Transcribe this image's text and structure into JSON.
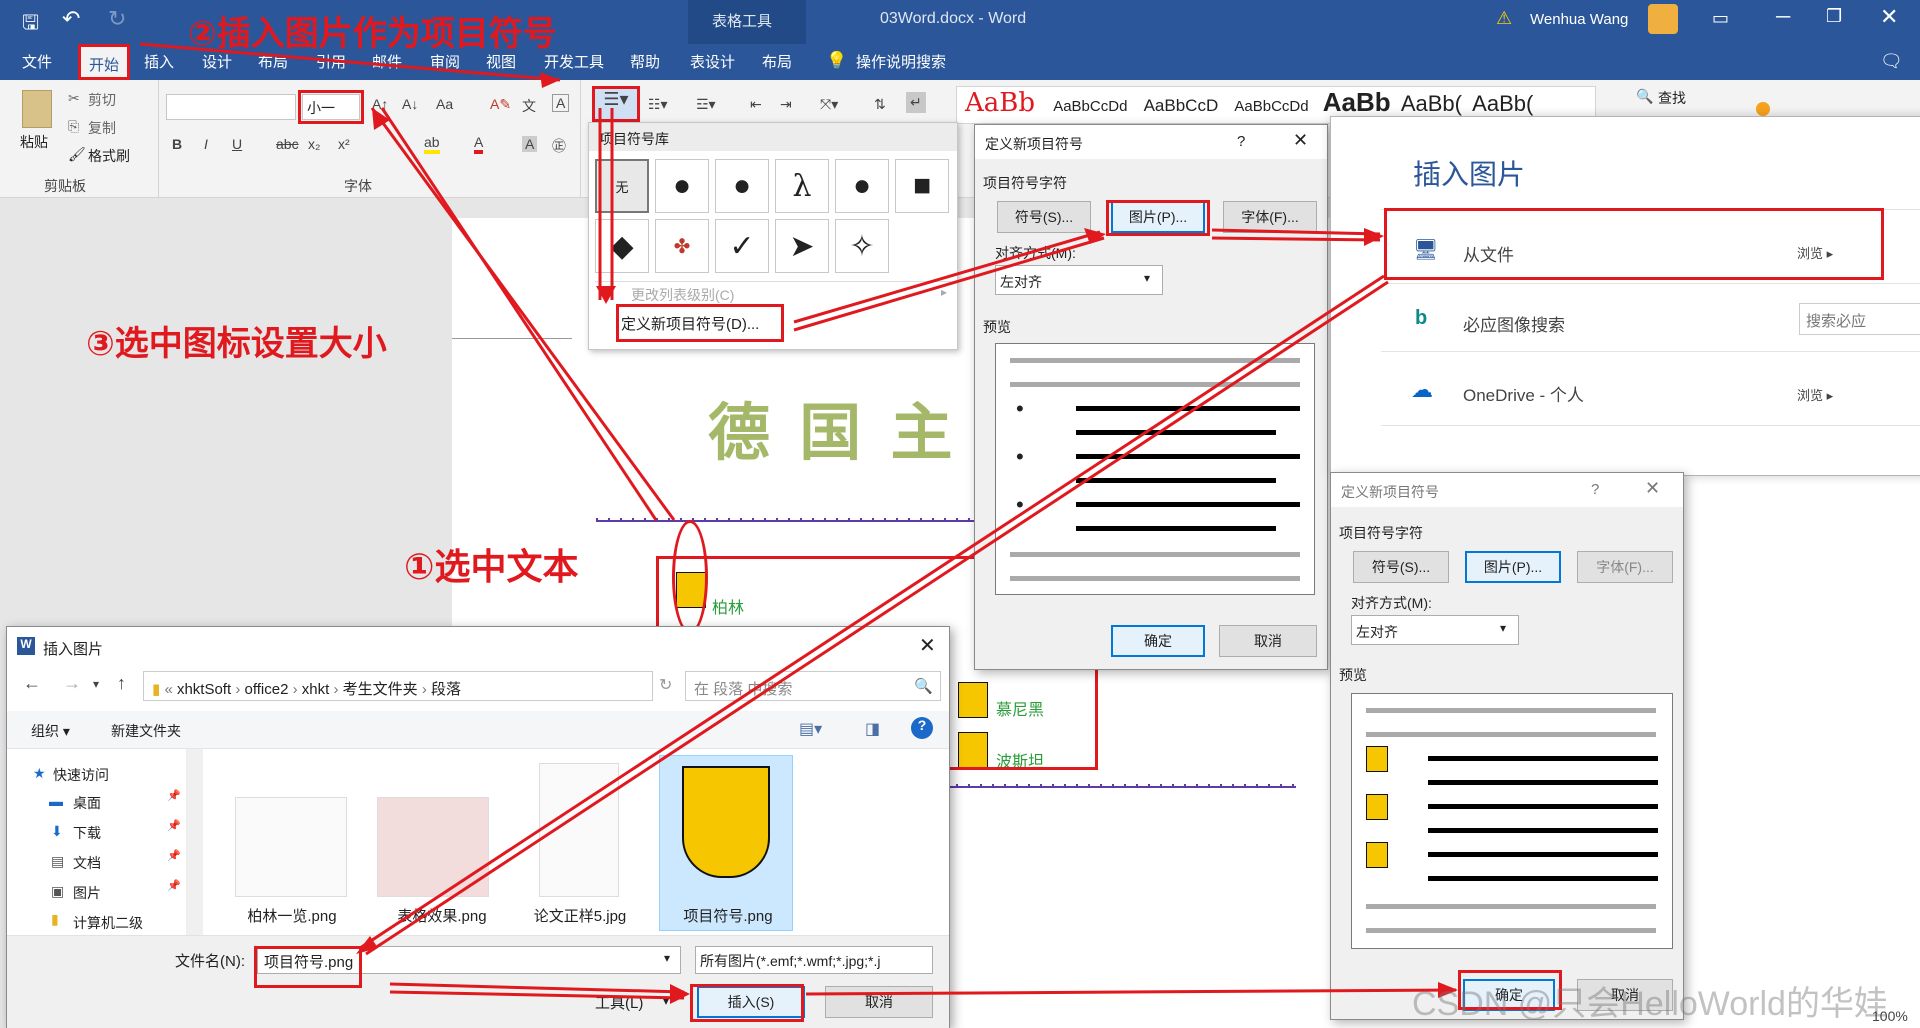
{
  "window": {
    "title": "03Word.docx - Word",
    "context_tab": "表格工具",
    "user": "Wenhua Wang"
  },
  "tabs": [
    "文件",
    "开始",
    "插入",
    "设计",
    "布局",
    "引用",
    "邮件",
    "审阅",
    "视图",
    "开发工具",
    "帮助",
    "表设计",
    "布局"
  ],
  "tell_me": "操作说明搜索",
  "clipboard": {
    "paste": "粘贴",
    "cut": "剪切",
    "copy": "复制",
    "format_painter": "格式刷",
    "group": "剪贴板"
  },
  "font": {
    "size": "小一",
    "group": "字体"
  },
  "styles": [
    "AaBb",
    "AaBbCcDd",
    "AaBbCcD",
    "AaBbCcDd",
    "AaBb",
    "AaBb(",
    "AaBb("
  ],
  "find": "查找",
  "gallery": {
    "header": "项目符号库",
    "none": "无",
    "symbols": [
      "●",
      "●",
      "λ",
      "●",
      "■",
      "◆",
      "✤",
      "✓",
      "➤",
      "✧"
    ],
    "change_level": "更改列表级别(C)",
    "define_new": "定义新项目符号(D)..."
  },
  "annotations": {
    "step1": "①选中文本",
    "step2": "②插入图片作为项目符号",
    "step3": "③选中图标设置大小"
  },
  "document": {
    "heading": "德 国 主 要",
    "items": [
      "柏林",
      "慕尼黑",
      "波斯坦"
    ]
  },
  "define_dialog": {
    "title": "定义新项目符号",
    "help": "?",
    "section": "项目符号字符",
    "symbol_btn": "符号(S)...",
    "picture_btn": "图片(P)...",
    "font_btn": "字体(F)...",
    "align_label": "对齐方式(M):",
    "align_value": "左对齐",
    "preview_label": "预览",
    "ok": "确定",
    "cancel": "取消"
  },
  "insert_pane": {
    "title": "插入图片",
    "rows": [
      {
        "label": "从文件",
        "action": "浏览 ▸"
      },
      {
        "label": "必应图像搜索",
        "action": "搜索必应"
      },
      {
        "label": "OneDrive - 个人",
        "action": "浏览 ▸"
      }
    ]
  },
  "file_dialog": {
    "title": "插入图片",
    "path": [
      "xhktSoft",
      "office2",
      "xhkt",
      "考生文件夹",
      "段落"
    ],
    "search_placeholder": "在 段落 中搜索",
    "organize": "组织 ▾",
    "new_folder": "新建文件夹",
    "nav": [
      "快速访问",
      "桌面",
      "下载",
      "文档",
      "图片",
      "计算机二级"
    ],
    "files": [
      "柏林一览.png",
      "表格效果.png",
      "论文正样5.jpg",
      "项目符号.png"
    ],
    "filename_label": "文件名(N):",
    "filename_value": "项目符号.png",
    "filetype": "所有图片(*.emf;*.wmf;*.jpg;*.j",
    "tools": "工具(L)",
    "insert_btn": "插入(S)",
    "cancel_btn": "取消"
  },
  "watermark": "CSDN @只会HelloWorld的华娃",
  "zoom": "100%",
  "colors": {
    "accent": "#2b579a",
    "annotation": "#e0191f",
    "heading": "#a5b86a",
    "doc_text": "#2a9d3a"
  }
}
